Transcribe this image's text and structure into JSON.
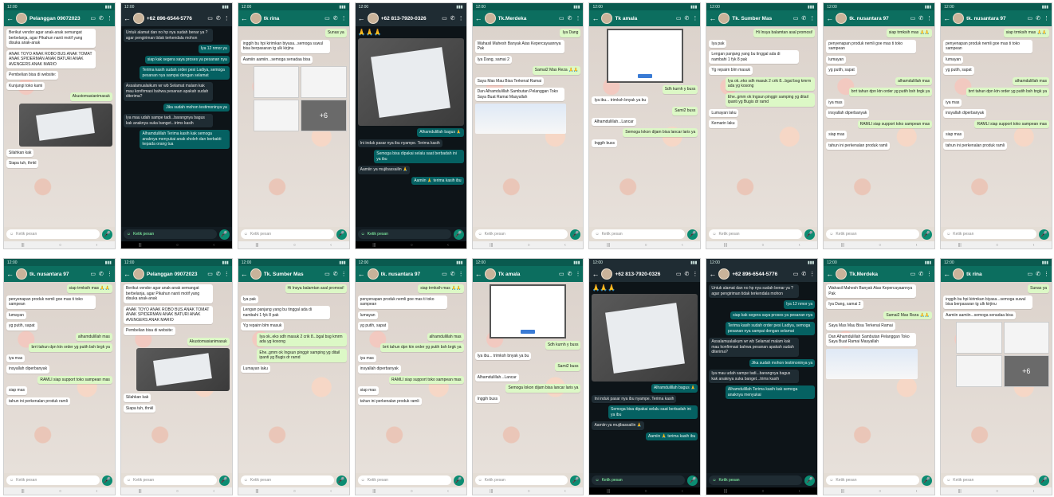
{
  "colors": {
    "header": "#0c6e5f",
    "bubble_out": "#dcf8c6",
    "bubble_in": "#ffffff",
    "dark_bg": "#121b21",
    "mic": "#0b8c72"
  },
  "input_placeholder": "Ketik pesan",
  "phones_top": [
    {
      "name": "Pelanggan 09072023",
      "theme": "light",
      "messages": [
        {
          "dir": "in",
          "text": "Berikut vendor agar anak-anak semangat berbelanja, agar Pikahun nanti motif yang disuka anak-anak"
        },
        {
          "dir": "in",
          "text": "ANAK TOYO ANAK ROBO BUS ANAK TOMAT ANAK SPIDERMAN ANAK BATURI ANAK AVENGERS ANAK MARIO"
        },
        {
          "dir": "in",
          "text": "Pembelian bisa di website:"
        },
        {
          "dir": "in",
          "text": "Kunjungi toko kami"
        },
        {
          "dir": "out",
          "text": "Akustomasianimasuk"
        },
        {
          "dir": "photo"
        },
        {
          "dir": "in",
          "text": "Silahkan kak"
        },
        {
          "dir": "in",
          "text": "Siapa tuh, thnkl"
        }
      ]
    },
    {
      "name": "+62 896-6544-5776",
      "theme": "dark",
      "messages": [
        {
          "dir": "in",
          "text": "Untuk alamat dan no hp nya sudah benar ya ? agar pengiriman tidak terkendala mohon"
        },
        {
          "dir": "out",
          "text": "Iya 12 nmor ya"
        },
        {
          "dir": "out",
          "text": "siap kak segera saya proses ya pesanan nya"
        },
        {
          "dir": "out",
          "text": "Terima kasih sudah order pesi Ladiya, semoga pesanan nya sampai dengan selamat"
        },
        {
          "dir": "in",
          "text": "Assalamualaikum wr wb Selamat malam kak mau konfirmasi bahwa pesanan apakah sudah diterima?"
        },
        {
          "dir": "out",
          "text": "Jika sudah mohon testimoninya ya"
        },
        {
          "dir": "in",
          "text": "Iya mau udah sampe tadi...barangnya bagus kak anaknya suka banget...trims kasih"
        },
        {
          "dir": "out",
          "text": "Alhamdulillah Terima kasih kak semoga anaknya menyukai anak sholeh dan berbakti kepada orang tua"
        }
      ]
    },
    {
      "name": "tk rina",
      "theme": "light",
      "messages": [
        {
          "dir": "out",
          "text": "Sunas ya"
        },
        {
          "dir": "in",
          "text": "inggih bu hpi kirimkan biyasa...semoga suwul bisa berpasaran tg ulk kirjinu"
        },
        {
          "dir": "in",
          "text": "Aamiin aamiin...semoga senadaa bisa"
        },
        {
          "dir": "grid"
        }
      ]
    },
    {
      "name": "+62 813-7920-0326",
      "theme": "dark",
      "messages": [
        {
          "dir": "emoji",
          "text": "🙏🙏🙏"
        },
        {
          "dir": "bigphoto"
        },
        {
          "dir": "out",
          "text": "Alhamdulillah bagus 🙏"
        },
        {
          "dir": "in",
          "text": "Ini induk pasar nya ibu nyampe. Terima kasih"
        },
        {
          "dir": "out",
          "text": "Semoga bisa dipakai selalu saat berbadah ini ya ibu"
        },
        {
          "dir": "in",
          "text": "Aamiin ya mujibassailin 🙏"
        },
        {
          "dir": "out",
          "text": "Aamiin 🙏 terima kasih ibu"
        }
      ]
    },
    {
      "name": "Tk.Merdeka",
      "theme": "light",
      "messages": [
        {
          "dir": "out",
          "text": "Iya Dang"
        },
        {
          "dir": "in",
          "text": "Wahasil Mahesh Banyak Atas Kepercayaannya Pak"
        },
        {
          "dir": "in",
          "text": "Iya Dang, samai 2"
        },
        {
          "dir": "out",
          "text": "Samai2 Mas Reza 🙏🙏"
        },
        {
          "dir": "in",
          "text": "Saya Mas Mau Bisa Terkenal Ramai"
        },
        {
          "dir": "in",
          "text": "Dan Alhamdulillah Sambutan Pelanggan Toko Saya Buat Ramai Masyallah"
        },
        {
          "dir": "poster"
        }
      ]
    },
    {
      "name": "Tk amala",
      "theme": "light",
      "messages": [
        {
          "dir": "shot"
        },
        {
          "dir": "out",
          "text": "Sdh kurnh y buss"
        },
        {
          "dir": "in",
          "text": "Iya ibu... trimksh bnyak ya bu"
        },
        {
          "dir": "out",
          "text": "Sami2 buss"
        },
        {
          "dir": "in",
          "text": "Alhamdulillah...Lancar"
        },
        {
          "dir": "out",
          "text": "Semoga lokon dijam bisa lancar laris ya"
        },
        {
          "dir": "in",
          "text": "Inggih buss"
        }
      ]
    },
    {
      "name": "Tk. Sumber Mas",
      "theme": "light",
      "messages": [
        {
          "dir": "out",
          "text": "Hi Insya balamtan asal promosi!"
        },
        {
          "dir": "in",
          "text": "Iya pak"
        },
        {
          "dir": "in",
          "text": "Lengan panjang yang bu tinggal ada di nambahi 1 fyk 8 pak"
        },
        {
          "dir": "in",
          "text": "Yg repairn blm masuk"
        },
        {
          "dir": "out",
          "text": "Iya ok..eko sdh masuk 2 crik 8...bgal bsg kmrm ada yg kosong"
        },
        {
          "dir": "out",
          "text": "Ehe..gmm ok Ingsun pinggir samping yg ditail ipanti yg Bugis dr ramd"
        },
        {
          "dir": "in",
          "text": "Lumayan laku"
        },
        {
          "dir": "in",
          "text": "Kemarin laku"
        }
      ]
    },
    {
      "name": "tk. nusantara 97",
      "theme": "light",
      "messages": [
        {
          "dir": "out",
          "text": "siap trmksih mas 🙏🙏"
        },
        {
          "dir": "in",
          "text": "penyenapan produk nemli goe mas ti toko sampean"
        },
        {
          "dir": "in",
          "text": "lumayan"
        },
        {
          "dir": "in",
          "text": "yg putih, sapat"
        },
        {
          "dir": "out",
          "text": "alhamdulillah mas"
        },
        {
          "dir": "out",
          "text": "brrt tahun dpn ktn order yg putih bsh brgk ya"
        },
        {
          "dir": "in",
          "text": "iya mas"
        },
        {
          "dir": "in",
          "text": "insyallah diperbanyak"
        },
        {
          "dir": "out",
          "text": "RAMLI siap support toko sampean mas"
        },
        {
          "dir": "in",
          "text": "siap mas"
        },
        {
          "dir": "in",
          "text": "tahun ini perkenalan produk ramli"
        }
      ]
    },
    {
      "name": "tk. nusantara 97",
      "theme": "light",
      "messages": [
        {
          "dir": "out",
          "text": "siap trmksih mas 🙏🙏"
        },
        {
          "dir": "in",
          "text": "penyenapan produk nemli goe mas ti toko sampean"
        },
        {
          "dir": "in",
          "text": "lumayan"
        },
        {
          "dir": "in",
          "text": "yg putih, sapat"
        },
        {
          "dir": "out",
          "text": "alhamdulillah mas"
        },
        {
          "dir": "out",
          "text": "brrt tahun dpn ktn order yg putih bsh brgk ya"
        },
        {
          "dir": "in",
          "text": "iya mas"
        },
        {
          "dir": "in",
          "text": "insyallah diperbanyak"
        },
        {
          "dir": "out",
          "text": "RAMLI siap support toko sampean mas"
        },
        {
          "dir": "in",
          "text": "siap mas"
        },
        {
          "dir": "in",
          "text": "tahun ini perkenalan produk ramli"
        }
      ]
    }
  ],
  "phones_bottom": [
    {
      "name": "tk. nusantara 97",
      "theme": "light",
      "messages": [
        {
          "dir": "out",
          "text": "siap trmksih mas 🙏🙏"
        },
        {
          "dir": "in",
          "text": "penyenapan produk nemli goe mas ti toko sampean"
        },
        {
          "dir": "in",
          "text": "lumayan"
        },
        {
          "dir": "in",
          "text": "yg putih, sapat"
        },
        {
          "dir": "out",
          "text": "alhamdulillah mas"
        },
        {
          "dir": "out",
          "text": "brrt tahun dpn ktn order yg putih bsh brgk ya"
        },
        {
          "dir": "in",
          "text": "iya mas"
        },
        {
          "dir": "in",
          "text": "insyallah diperbanyak"
        },
        {
          "dir": "out",
          "text": "RAMLI siap support toko sampean mas"
        },
        {
          "dir": "in",
          "text": "siap mas"
        },
        {
          "dir": "in",
          "text": "tahun ini perkenalan produk ramli"
        }
      ]
    },
    {
      "name": "Pelanggan 09072023",
      "theme": "light",
      "messages": [
        {
          "dir": "in",
          "text": "Berikut vendor agar anak-anak semangat berbelanja, agar Pikahun nanti motif yang disuka anak-anak"
        },
        {
          "dir": "in",
          "text": "ANAK TOYO ANAK ROBO BUS ANAK TOMAT ANAK SPIDERMAN ANAK BATURI ANAK AVENGERS ANAK MARIO"
        },
        {
          "dir": "in",
          "text": "Pembelian bisa di website:"
        },
        {
          "dir": "out",
          "text": "Akustomasianimasuk"
        },
        {
          "dir": "photo"
        },
        {
          "dir": "in",
          "text": "Silahkan kak"
        },
        {
          "dir": "in",
          "text": "Siapa tuh, thnkl"
        }
      ]
    },
    {
      "name": "Tk. Sumber Mas",
      "theme": "light",
      "messages": [
        {
          "dir": "out",
          "text": "Hi Insya balamtan asal promosi!"
        },
        {
          "dir": "in",
          "text": "Iya pak"
        },
        {
          "dir": "in",
          "text": "Lengan panjang yang bu tinggal ada di nambahi 1 fyk 8 pak"
        },
        {
          "dir": "in",
          "text": "Yg repairn blm masuk"
        },
        {
          "dir": "out",
          "text": "Iya ok..eko sdh masuk 2 crik 8...bgal bsg kmrm ada yg kosong"
        },
        {
          "dir": "out",
          "text": "Ehe..gmm ok Ingsun pinggir samping yg ditail ipanti yg Bugis dr ramd"
        },
        {
          "dir": "in",
          "text": "Lumayan laku"
        }
      ]
    },
    {
      "name": "tk. nusantara 97",
      "theme": "light",
      "messages": [
        {
          "dir": "out",
          "text": "siap trmksih mas 🙏🙏"
        },
        {
          "dir": "in",
          "text": "penyenapan produk nemli goe mas ti toko sampean"
        },
        {
          "dir": "in",
          "text": "lumayan"
        },
        {
          "dir": "in",
          "text": "yg putih, sapat"
        },
        {
          "dir": "out",
          "text": "alhamdulillah mas"
        },
        {
          "dir": "out",
          "text": "brrt tahun dpn ktn order yg putih bsh brgk ya"
        },
        {
          "dir": "in",
          "text": "iya mas"
        },
        {
          "dir": "in",
          "text": "insyallah diperbanyak"
        },
        {
          "dir": "out",
          "text": "RAMLI siap support toko sampean mas"
        },
        {
          "dir": "in",
          "text": "siap mas"
        },
        {
          "dir": "in",
          "text": "tahun ini perkenalan produk ramli"
        }
      ]
    },
    {
      "name": "Tk amala",
      "theme": "light",
      "messages": [
        {
          "dir": "shot"
        },
        {
          "dir": "out",
          "text": "Sdh kurnh y buss"
        },
        {
          "dir": "in",
          "text": "Iya ibu... trimksh bnyak ya bu"
        },
        {
          "dir": "out",
          "text": "Sami2 buss"
        },
        {
          "dir": "in",
          "text": "Alhamdulillah...Lancar"
        },
        {
          "dir": "out",
          "text": "Semoga lokon dijam bisa lancar laris ya"
        },
        {
          "dir": "in",
          "text": "Inggih buss"
        }
      ]
    },
    {
      "name": "+62 813-7920-0326",
      "theme": "dark",
      "messages": [
        {
          "dir": "emoji",
          "text": "🙏🙏🙏"
        },
        {
          "dir": "bigphoto"
        },
        {
          "dir": "out",
          "text": "Alhamdulillah bagus 🙏"
        },
        {
          "dir": "in",
          "text": "Ini induk pasar nya ibu nyampe. Terima kasih"
        },
        {
          "dir": "out",
          "text": "Semoga bisa dipakai selalu saat berbadah ini ya ibu"
        },
        {
          "dir": "in",
          "text": "Aamiin ya mujibassailin 🙏"
        },
        {
          "dir": "out",
          "text": "Aamiin 🙏 terima kasih ibu"
        }
      ]
    },
    {
      "name": "+62 896-6544-5776",
      "theme": "dark",
      "messages": [
        {
          "dir": "in",
          "text": "Untuk alamat dan no hp nya sudah benar ya ? agar pengiriman tidak terkendala mohon"
        },
        {
          "dir": "out",
          "text": "Iya 12 nmor ya"
        },
        {
          "dir": "out",
          "text": "siap kak segera saya proses ya pesanan nya"
        },
        {
          "dir": "out",
          "text": "Terima kasih sudah order pesi Ladiya, semoga pesanan nya sampai dengan selamat"
        },
        {
          "dir": "in",
          "text": "Assalamualaikum wr wb Selamat malam kak mau konfirmasi bahwa pesanan apakah sudah diterima?"
        },
        {
          "dir": "out",
          "text": "Jika sudah mohon testimoninya ya"
        },
        {
          "dir": "in",
          "text": "Iya mau udah sampe tadi...barangnya bagus kak anaknya suka banget...trims kasih"
        },
        {
          "dir": "out",
          "text": "Alhamdulillah Terima kasih kak semoga anaknya menyukai"
        }
      ]
    },
    {
      "name": "Tk.Merdeka",
      "theme": "light",
      "messages": [
        {
          "dir": "in",
          "text": "Wahasil Mahesh Banyak Atas Kepercayaannya Pak"
        },
        {
          "dir": "in",
          "text": "Iya Dang, samai 2"
        },
        {
          "dir": "out",
          "text": "Samai2 Mas Reza 🙏🙏"
        },
        {
          "dir": "in",
          "text": "Saya Mas Mau Bisa Terkenal Ramai"
        },
        {
          "dir": "in",
          "text": "Dan Alhamdulillah Sambutan Pelanggan Toko Saya Buat Ramai Masyallah"
        },
        {
          "dir": "poster"
        }
      ]
    },
    {
      "name": "tk rina",
      "theme": "light",
      "messages": [
        {
          "dir": "out",
          "text": "Sunas ya"
        },
        {
          "dir": "in",
          "text": "inggih bu hpi kirimkan biyasa...semoga suwul bisa berpasaran tg ulk kirjinu"
        },
        {
          "dir": "in",
          "text": "Aamiin aamiin...semoga senadaa bisa"
        },
        {
          "dir": "grid"
        }
      ]
    }
  ]
}
